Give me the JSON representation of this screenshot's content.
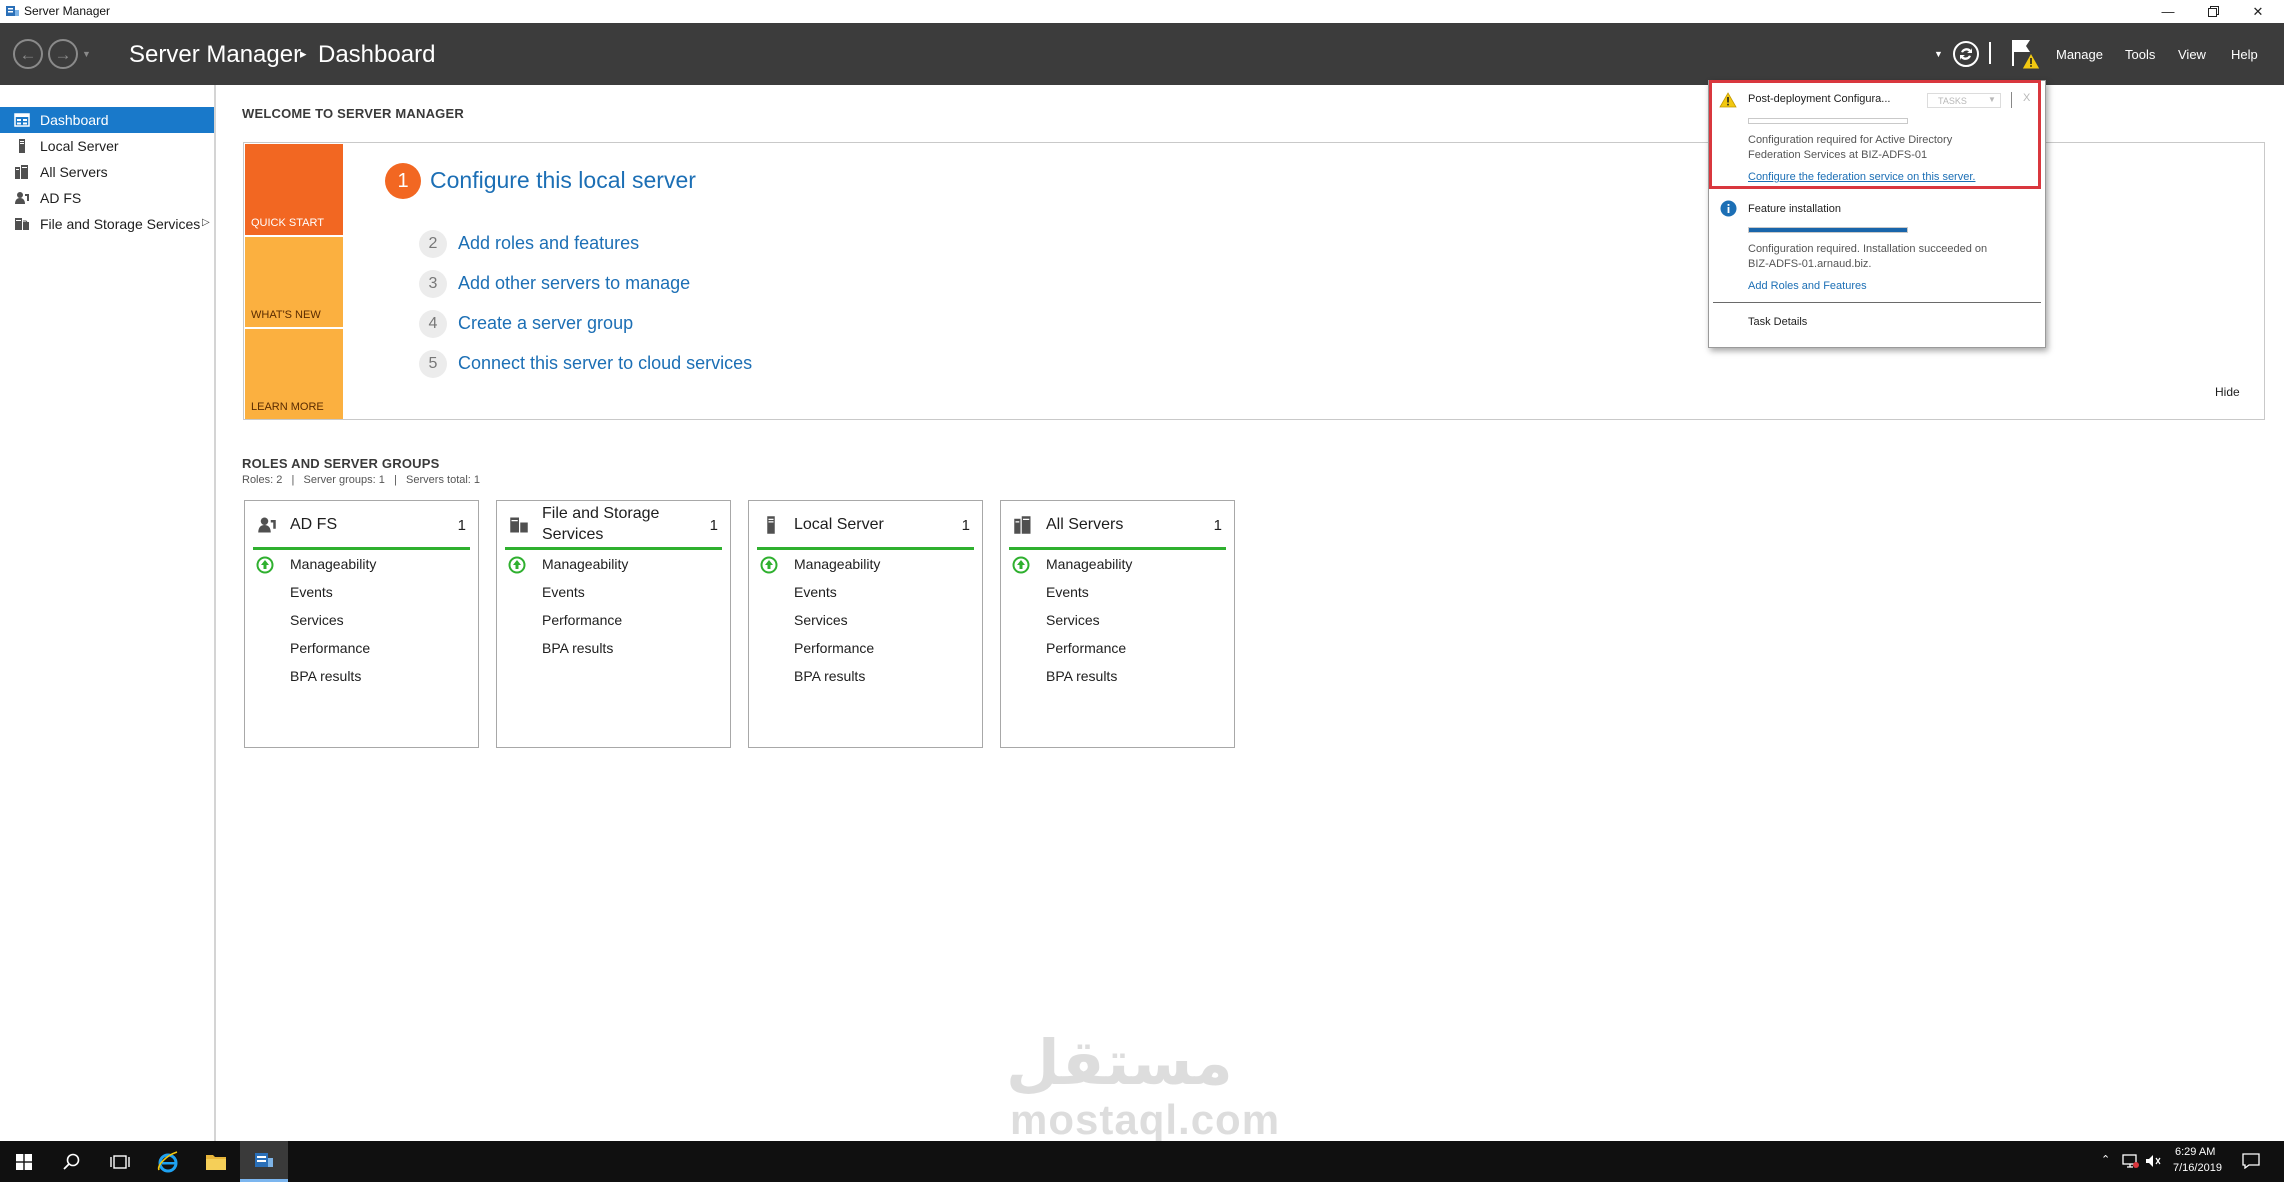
{
  "window": {
    "title": "Server Manager",
    "icon": "server-manager-icon",
    "controls": [
      "minimize-icon",
      "restore-icon",
      "close-icon"
    ]
  },
  "header": {
    "breadcrumb_root": "Server Manager",
    "breadcrumb_separator": "▸",
    "breadcrumb_current": "Dashboard",
    "menu": [
      "Manage",
      "Tools",
      "View",
      "Help"
    ]
  },
  "sidebar": {
    "items": [
      {
        "label": "Dashboard",
        "icon": "dashboard-icon",
        "active": true
      },
      {
        "label": "Local Server",
        "icon": "server-icon"
      },
      {
        "label": "All Servers",
        "icon": "servers-icon"
      },
      {
        "label": "AD FS",
        "icon": "adfs-icon"
      },
      {
        "label": "File and Storage Services",
        "icon": "storage-icon",
        "has_submenu": true
      }
    ]
  },
  "welcome": {
    "title": "WELCOME TO SERVER MANAGER",
    "tiles": [
      "QUICK START",
      "WHAT'S NEW",
      "LEARN MORE"
    ],
    "main_step_number": "1",
    "main_step_label": "Configure this local server",
    "steps": [
      {
        "num": "2",
        "label": "Add roles and features"
      },
      {
        "num": "3",
        "label": "Add other servers to manage"
      },
      {
        "num": "4",
        "label": "Create a server group"
      },
      {
        "num": "5",
        "label": "Connect this server to cloud services"
      }
    ],
    "hide_label": "Hide"
  },
  "roles": {
    "title": "ROLES AND SERVER GROUPS",
    "summary": "Roles: 2   |   Server groups: 1   |   Servers total: 1",
    "cards": [
      {
        "title_line1": "AD FS",
        "title_line2": "",
        "count": "1",
        "icon": "adfs-icon",
        "rows": [
          "Manageability",
          "Events",
          "Services",
          "Performance",
          "BPA results"
        ]
      },
      {
        "title_line1": "File and Storage",
        "title_line2": "Services",
        "count": "1",
        "icon": "storage-icon",
        "rows": [
          "Manageability",
          "Events",
          "Performance",
          "BPA results"
        ]
      },
      {
        "title_line1": "Local Server",
        "title_line2": "",
        "count": "1",
        "icon": "server-icon",
        "rows": [
          "Manageability",
          "Events",
          "Services",
          "Performance",
          "BPA results"
        ]
      },
      {
        "title_line1": "All Servers",
        "title_line2": "",
        "count": "1",
        "icon": "servers-icon",
        "rows": [
          "Manageability",
          "Events",
          "Services",
          "Performance",
          "BPA results"
        ]
      }
    ]
  },
  "notifications": {
    "item1": {
      "title": "Post-deployment Configura...",
      "tasks_label": "TASKS",
      "close_label": "X",
      "line1": "Configuration required for Active Directory",
      "line2": "Federation Services at BIZ-ADFS-01",
      "link": "Configure the federation service on this server.",
      "progress": 0
    },
    "item2": {
      "title": "Feature installation",
      "line1": "Configuration required. Installation succeeded on",
      "line2": "BIZ-ADFS-01.arnaud.biz.",
      "link": "Add Roles and Features",
      "progress": 1
    },
    "task_details": "Task Details"
  },
  "taskbar": {
    "time": "6:29 AM",
    "date": "7/16/2019",
    "icons": [
      "start-icon",
      "search-icon",
      "task-view-icon",
      "ie-icon",
      "file-explorer-icon",
      "server-manager-icon"
    ]
  },
  "watermark": {
    "arabic": "مستقل",
    "latin": "mostaql.com"
  },
  "colors": {
    "header_bg": "#3c3c3c",
    "accent": "#1979ca",
    "quick_start": "#f26722",
    "whats_new": "#fbb040",
    "learn_more": "#fbb040",
    "status_green": "#2fb02f",
    "link": "#1c6fb5",
    "highlight": "#d9373e"
  }
}
